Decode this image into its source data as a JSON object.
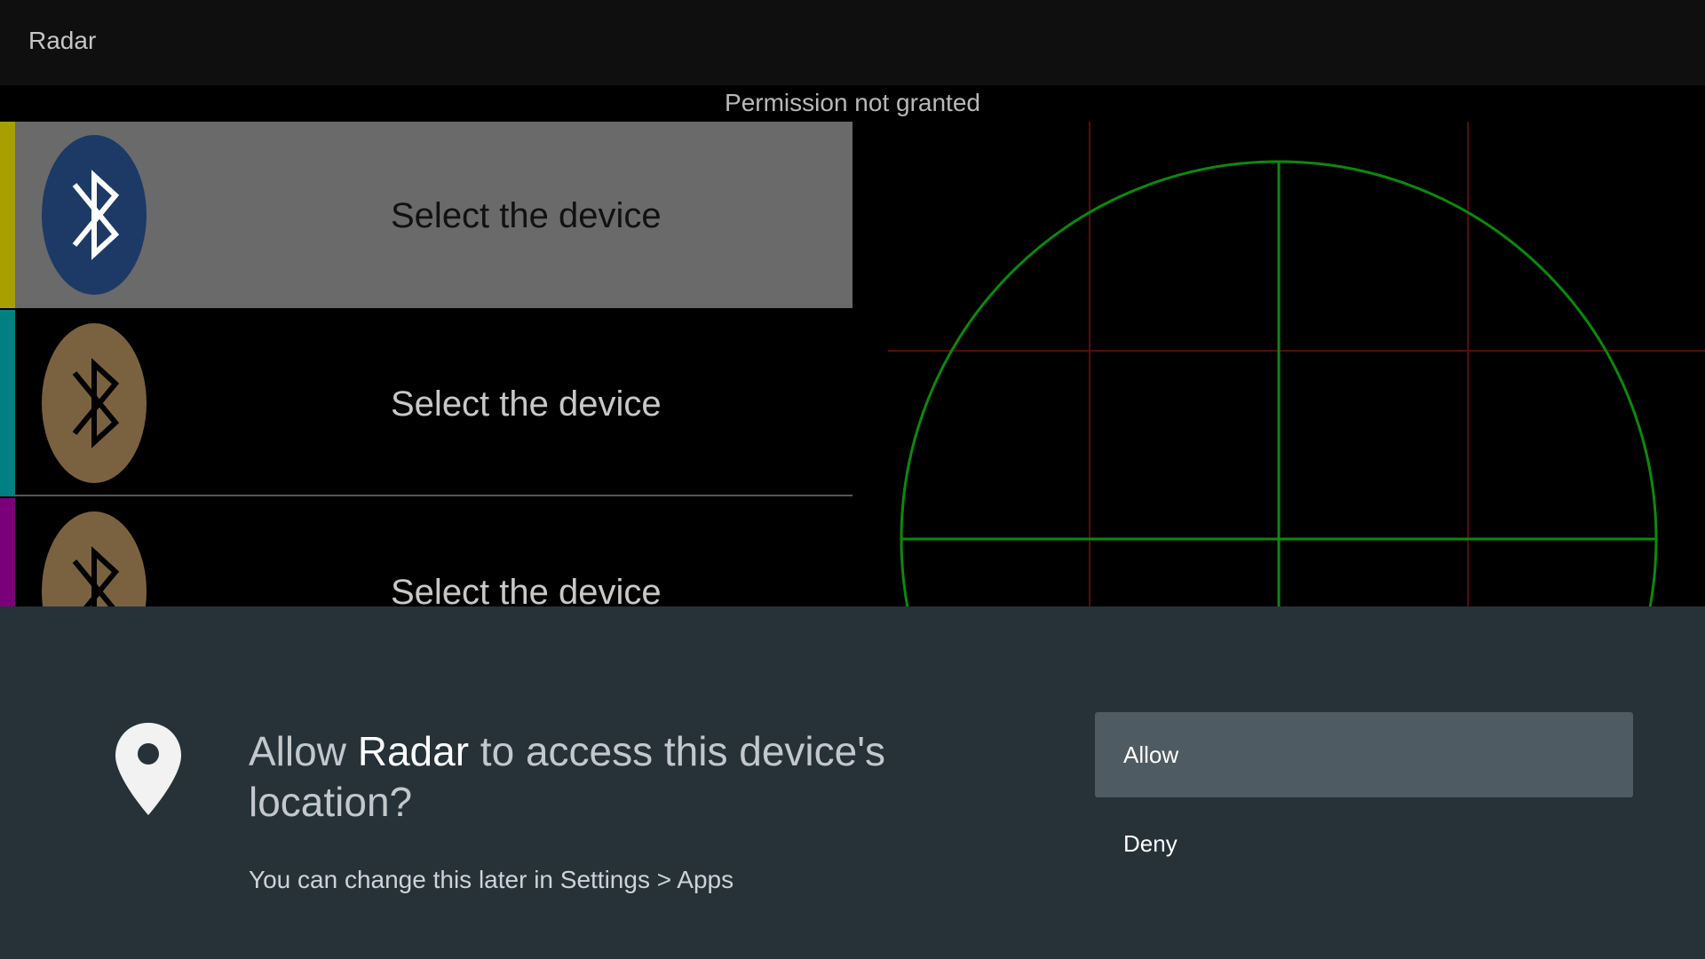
{
  "app": {
    "title": "Radar"
  },
  "status": {
    "text": "Permission not granted"
  },
  "device_list": {
    "items": [
      {
        "label": "Select the device",
        "selected": true,
        "accent_color": "#a8a000",
        "icon_color": "#1d3a66",
        "icon": "bluetooth-icon",
        "label_color": "#111111"
      },
      {
        "label": "Select the device",
        "selected": false,
        "accent_color": "#008080",
        "icon_color": "#7a6240",
        "icon": "bluetooth-icon",
        "label_color": "#c8c8c8"
      },
      {
        "label": "Select the device",
        "selected": false,
        "accent_color": "#7a007a",
        "icon_color": "#7a6240",
        "icon": "bluetooth-icon",
        "label_color": "#c8c8c8"
      }
    ]
  },
  "radar": {
    "ring_color": "#0a8a0a",
    "grid_color": "#5a0a0a"
  },
  "permission_dialog": {
    "icon": "location-pin-icon",
    "prompt_prefix": "Allow ",
    "app_name": "Radar",
    "prompt_suffix": " to access this device's location?",
    "hint": "You can change this later in Settings > Apps",
    "allow_label": "Allow",
    "deny_label": "Deny",
    "background_color": "#263238"
  }
}
